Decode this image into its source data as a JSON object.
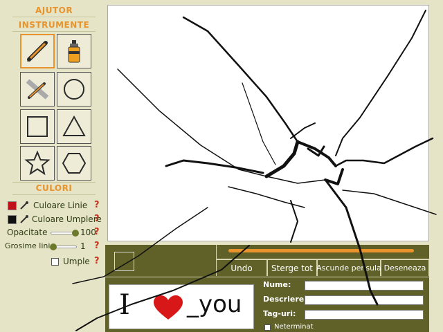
{
  "panel": {
    "help_label": "AJUTOR",
    "tools_title": "INSTRUMENTE",
    "colors_title": "CULORI",
    "tools": [
      "pencil",
      "spray",
      "eraser",
      "circle",
      "square",
      "triangle",
      "star",
      "hexagon"
    ]
  },
  "colors": {
    "line_label": "Culoare Linie",
    "fill_label": "Culoare Umplere",
    "opacity_label": "Opacitate",
    "opacity_value": "100",
    "width_label": "Grosime linie",
    "width_value": "1",
    "fill_check_label": "Umple",
    "help_mark": "?",
    "line_color": "#c0101a",
    "fill_color": "#111111"
  },
  "toolbar": {
    "undo": "Undo",
    "clear": "Sterge tot",
    "hide_brush": "Ascunde pensula",
    "draw": "Deseneaza"
  },
  "form": {
    "name_label": "Nume:",
    "desc_label": "Descriere:",
    "tags_label": "Tag-uri:",
    "unfinished_label": "Neterminat",
    "name_value": "",
    "desc_value": "",
    "tags_value": ""
  },
  "thumbnail": {
    "letter": "I",
    "word": "_you"
  },
  "accent_color": "#e8932c"
}
